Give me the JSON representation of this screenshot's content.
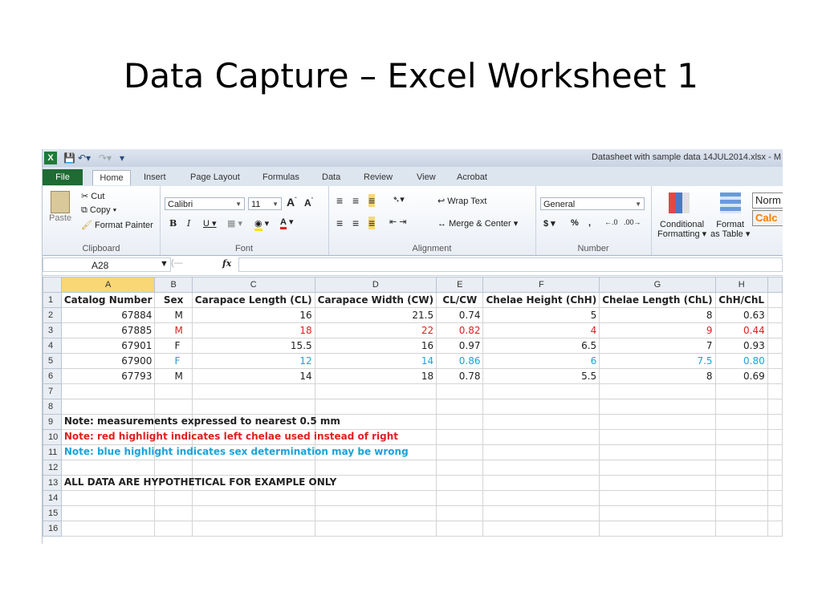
{
  "slide_title": "Data Capture – Excel Worksheet 1",
  "window": {
    "title": "Datasheet with sample data 14JUL2014.xlsx - M"
  },
  "tabs": [
    "File",
    "Home",
    "Insert",
    "Page Layout",
    "Formulas",
    "Data",
    "Review",
    "View",
    "Acrobat"
  ],
  "ribbon": {
    "clipboard": {
      "paste": "Paste",
      "cut": "Cut",
      "copy": "Copy",
      "format_painter": "Format Painter",
      "label": "Clipboard"
    },
    "font": {
      "name": "Calibri",
      "size": "11",
      "label": "Font"
    },
    "alignment": {
      "wrap": "Wrap Text",
      "merge": "Merge & Center",
      "label": "Alignment"
    },
    "number": {
      "format": "General",
      "currency": "$",
      "percent": "%",
      "comma": ",",
      "label": "Number"
    },
    "styles": {
      "conditional": "Conditional",
      "formatting": "Formatting",
      "format": "Format",
      "as_table": "as Table",
      "normal": "Norm",
      "calc": "Calc"
    }
  },
  "formula_bar": {
    "name_box": "A28",
    "fx": "fx",
    "value": ""
  },
  "sheet": {
    "columns": [
      "A",
      "B",
      "C",
      "D",
      "E",
      "F",
      "G",
      "H"
    ],
    "headers": [
      "Catalog Number",
      "Sex",
      "Carapace Length (CL)",
      "Carapace Width (CW)",
      "CL/CW",
      "Chelae Height (ChH)",
      "Chelae Length (ChL)",
      "ChH/ChL"
    ],
    "rows": [
      [
        "67884",
        "M",
        "16",
        "21.5",
        "0.74",
        "5",
        "8",
        "0.63"
      ],
      [
        "67885",
        "M",
        "18",
        "22",
        "0.82",
        "4",
        "9",
        "0.44"
      ],
      [
        "67901",
        "F",
        "15.5",
        "16",
        "0.97",
        "6.5",
        "7",
        "0.93"
      ],
      [
        "67900",
        "F",
        "12",
        "14",
        "0.86",
        "6",
        "7.5",
        "0.80"
      ],
      [
        "67793",
        "M",
        "14",
        "18",
        "0.78",
        "5.5",
        "8",
        "0.69"
      ]
    ],
    "notes": {
      "n9": "Note: measurements expressed to nearest 0.5 mm",
      "n10": "Note: red highlight indicates left chelae used instead of right",
      "n11": "Note: blue highlight indicates sex determination may be wrong",
      "n13": "ALL DATA ARE HYPOTHETICAL FOR EXAMPLE ONLY"
    },
    "row_numbers": [
      "1",
      "2",
      "3",
      "4",
      "5",
      "6",
      "7",
      "8",
      "9",
      "10",
      "11",
      "12",
      "13",
      "14",
      "15",
      "16"
    ]
  },
  "colors": {
    "red": "#e02020",
    "blue": "#1ba3d8",
    "excel_green": "#1f6b33",
    "selected_header": "#f8d774"
  }
}
